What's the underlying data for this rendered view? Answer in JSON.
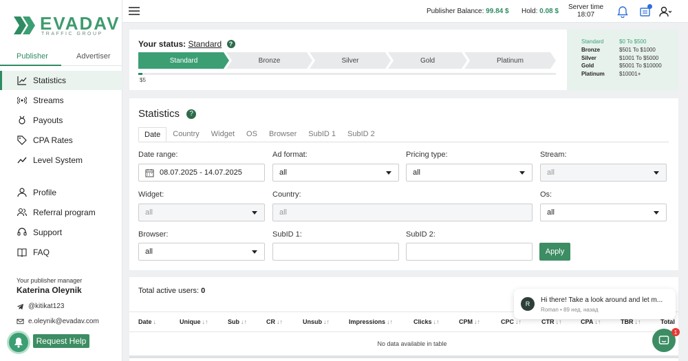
{
  "brand": {
    "name": "EVADAV",
    "tagline": "TRAFFIC GROUP",
    "accent": "#3c9f74"
  },
  "sidebar": {
    "role_tabs": [
      {
        "label": "Publisher",
        "active": true
      },
      {
        "label": "Advertiser",
        "active": false
      }
    ],
    "items": [
      {
        "label": "Statistics",
        "icon": "chart-icon",
        "active": true
      },
      {
        "label": "Streams",
        "icon": "broadcast-icon"
      },
      {
        "label": "Payouts",
        "icon": "medal-icon"
      },
      {
        "label": "CPA Rates",
        "icon": "tag-icon"
      },
      {
        "label": "Level System",
        "icon": "trend-icon"
      },
      {
        "label": "Profile",
        "icon": "user-icon"
      },
      {
        "label": "Referral program",
        "icon": "users-icon"
      },
      {
        "label": "Support",
        "icon": "headset-icon"
      },
      {
        "label": "FAQ",
        "icon": "book-icon"
      }
    ],
    "manager": {
      "label": "Your publisher manager",
      "name": "Katerina Oleynik",
      "telegram": "@kitikat123",
      "email": "e.oleynik@evadav.com"
    },
    "help_button": "Request Help"
  },
  "topbar": {
    "balance_label": "Publisher Balance:",
    "balance_value": "99.84 $",
    "hold_label": "Hold:",
    "hold_value": "0.08 $",
    "server_time_label": "Server time",
    "server_time_value": "18:07"
  },
  "status": {
    "label": "Your status:",
    "current": "Standard",
    "levels": [
      "Standard",
      "Bronze",
      "Silver",
      "Gold",
      "Platinum"
    ],
    "progress_value": "$5",
    "progress_fraction": 0.01,
    "tiers": [
      {
        "name": "Standard",
        "range": "$0 To $500",
        "active": true
      },
      {
        "name": "Bronze",
        "range": "$501 To $1000"
      },
      {
        "name": "Silver",
        "range": "$1001 To $5000"
      },
      {
        "name": "Gold",
        "range": "$5001 To $10000"
      },
      {
        "name": "Platinum",
        "range": "$10001+"
      }
    ]
  },
  "statistics": {
    "title": "Statistics",
    "tabs": [
      "Date",
      "Country",
      "Widget",
      "OS",
      "Browser",
      "SubID 1",
      "SubID 2"
    ],
    "filters": {
      "date_range_label": "Date range:",
      "date_range_value": "08.07.2025 - 14.07.2025",
      "ad_format_label": "Ad format:",
      "ad_format_value": "all",
      "pricing_type_label": "Pricing type:",
      "pricing_type_value": "all",
      "stream_label": "Stream:",
      "stream_value": "all",
      "widget_label": "Widget:",
      "widget_value": "all",
      "country_label": "Country:",
      "country_value": "all",
      "os_label": "Os:",
      "os_value": "all",
      "browser_label": "Browser:",
      "browser_value": "all",
      "subid1_label": "SubID 1:",
      "subid1_value": "",
      "subid2_label": "SubID 2:",
      "subid2_value": ""
    },
    "apply_label": "Apply"
  },
  "table": {
    "active_users_label": "Total active users:",
    "active_users_value": "0",
    "columns": [
      "Date",
      "Unique",
      "Sub",
      "CR",
      "Unsub",
      "Impressions",
      "Clicks",
      "CPM",
      "CPC",
      "CTR",
      "CPA",
      "TBR",
      "Total"
    ],
    "empty_text": "No data available in table"
  },
  "chat": {
    "avatar_letter": "R",
    "message": "Hi there! Take a look around and let m...",
    "meta": "Roman • 89 нед. назад",
    "badge": "1"
  }
}
